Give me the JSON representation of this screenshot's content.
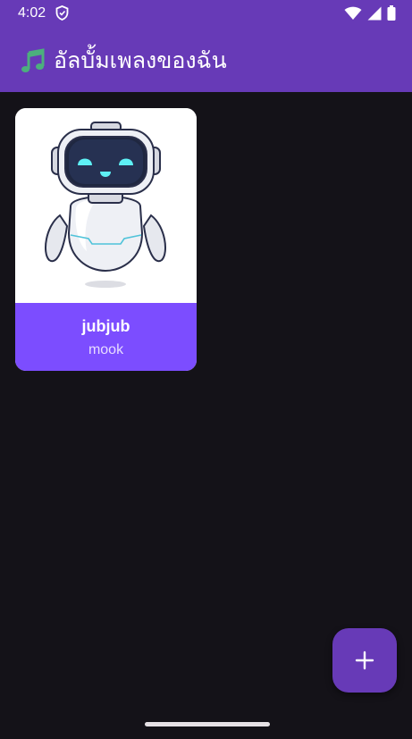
{
  "status_bar": {
    "time": "4:02",
    "icons": [
      "shield-icon",
      "wifi-icon",
      "signal-icon",
      "battery-icon"
    ]
  },
  "app_bar": {
    "title": "อัลบั้มเพลงของฉัน",
    "icon": "music-note-icon"
  },
  "albums": [
    {
      "title": "jubjub",
      "artist": "mook",
      "cover": "robot-mascot"
    }
  ],
  "fab": {
    "icon": "plus-icon"
  },
  "colors": {
    "primary": "#673ab7",
    "card_footer": "#7c4dff",
    "background": "#141218"
  }
}
